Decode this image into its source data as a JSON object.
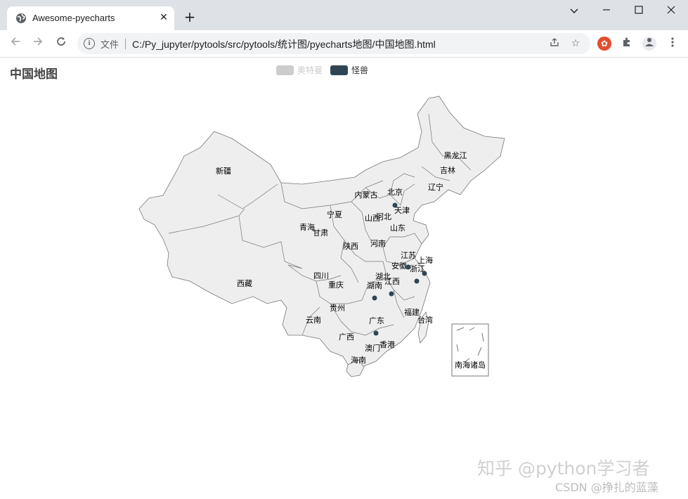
{
  "browser": {
    "tab_title": "Awesome-pyecharts",
    "file_label": "文件",
    "url": "C:/Py_jupyter/pytools/src/pytools/统计图/pyecharts地图/中国地图.html",
    "icons": [
      "globe-icon",
      "close-icon",
      "plus-icon",
      "chevron-down-icon",
      "minimize-icon",
      "maximize-icon",
      "close-window-icon",
      "back-icon",
      "forward-icon",
      "reload-icon",
      "info-icon",
      "share-icon",
      "star-icon",
      "extension-icon",
      "puzzle-icon",
      "profile-icon",
      "more-icon"
    ]
  },
  "chart": {
    "title": "中国地图",
    "legend": [
      {
        "name": "奥特曼",
        "color": "#cccccc",
        "selected": false
      },
      {
        "name": "怪兽",
        "color": "#2f4554",
        "selected": true
      }
    ],
    "map_fill": "#eeeeee",
    "map_border": "#777777",
    "point_color": "#2f4554",
    "provinces": [
      "黑龙江",
      "吉林",
      "辽宁",
      "新疆",
      "内蒙古",
      "北京",
      "天津",
      "宁夏",
      "河北",
      "山西",
      "青海",
      "甘肃",
      "山东",
      "陕西",
      "河南",
      "江苏",
      "上海",
      "安徽",
      "浙江",
      "四川",
      "湖北",
      "西藏",
      "重庆",
      "湖南",
      "江西",
      "贵州",
      "福建",
      "云南",
      "台湾",
      "广东",
      "广西",
      "香港",
      "澳门",
      "海南",
      "南海诸岛"
    ]
  },
  "watermark": {
    "zhihu": "知乎 @python学习者",
    "csdn": "CSDN @挣扎的蓝藻"
  }
}
